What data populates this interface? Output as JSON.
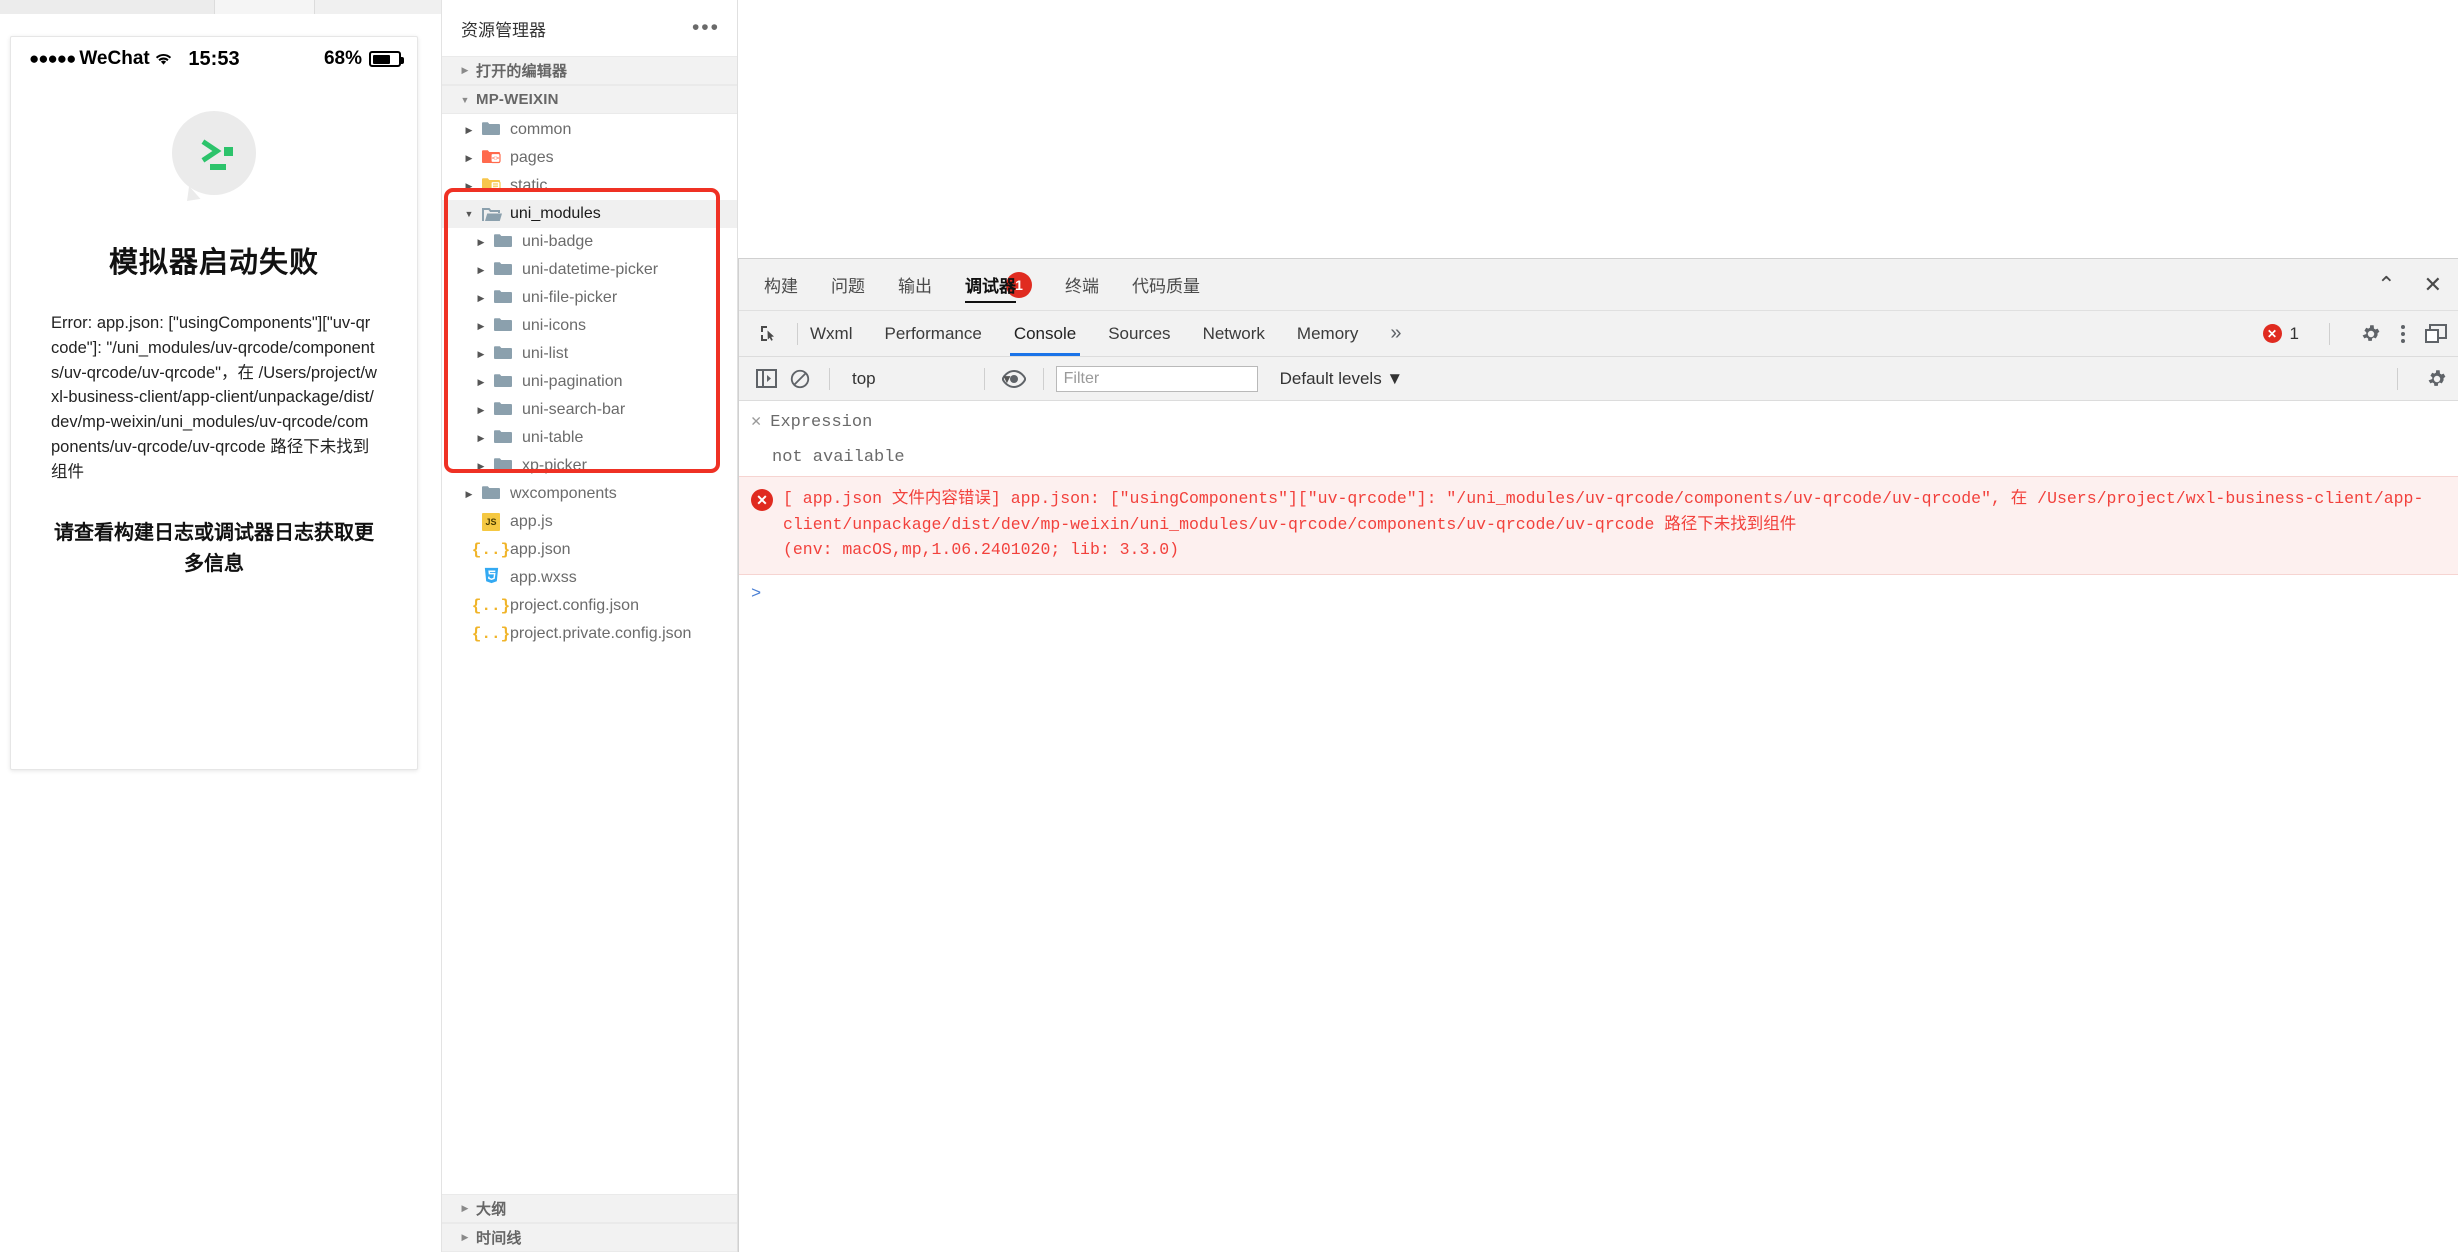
{
  "simulator": {
    "status_bar": {
      "carrier": "WeChat",
      "dots": "●●●●●",
      "time": "15:53",
      "battery_percent": "68%"
    },
    "title": "模拟器启动失败",
    "error_text": "Error: app.json: [\"usingComponents\"][\"uv-qrcode\"]: \"/uni_modules/uv-qrcode/components/uv-qrcode/uv-qrcode\"，在 /Users/project/wxl-business-client/app-client/unpackage/dist/dev/mp-weixin/uni_modules/uv-qrcode/components/uv-qrcode/uv-qrcode 路径下未找到组件",
    "hint_text": "请查看构建日志或调试器日志获取更多信息"
  },
  "explorer": {
    "title": "资源管理器",
    "more_label": "•••",
    "open_editors_label": "打开的编辑器",
    "project_label": "MP-WEIXIN",
    "outline_label": "大纲",
    "timeline_label": "时间线",
    "tree": [
      {
        "label": "common",
        "type": "folder",
        "icon": "folder-gray",
        "indent": 1,
        "expanded": false,
        "selected": false
      },
      {
        "label": "pages",
        "type": "folder",
        "icon": "folder-orange",
        "indent": 1,
        "expanded": false,
        "selected": false
      },
      {
        "label": "static",
        "type": "folder",
        "icon": "folder-yellow",
        "indent": 1,
        "expanded": false,
        "selected": false
      },
      {
        "label": "uni_modules",
        "type": "folder",
        "icon": "folder-open",
        "indent": 1,
        "expanded": true,
        "selected": true
      },
      {
        "label": "uni-badge",
        "type": "folder",
        "icon": "folder-gray",
        "indent": 2,
        "expanded": false,
        "selected": false
      },
      {
        "label": "uni-datetime-picker",
        "type": "folder",
        "icon": "folder-gray",
        "indent": 2,
        "expanded": false,
        "selected": false
      },
      {
        "label": "uni-file-picker",
        "type": "folder",
        "icon": "folder-gray",
        "indent": 2,
        "expanded": false,
        "selected": false
      },
      {
        "label": "uni-icons",
        "type": "folder",
        "icon": "folder-gray",
        "indent": 2,
        "expanded": false,
        "selected": false
      },
      {
        "label": "uni-list",
        "type": "folder",
        "icon": "folder-gray",
        "indent": 2,
        "expanded": false,
        "selected": false
      },
      {
        "label": "uni-pagination",
        "type": "folder",
        "icon": "folder-gray",
        "indent": 2,
        "expanded": false,
        "selected": false
      },
      {
        "label": "uni-search-bar",
        "type": "folder",
        "icon": "folder-gray",
        "indent": 2,
        "expanded": false,
        "selected": false
      },
      {
        "label": "uni-table",
        "type": "folder",
        "icon": "folder-gray",
        "indent": 2,
        "expanded": false,
        "selected": false
      },
      {
        "label": "xp-picker",
        "type": "folder",
        "icon": "folder-gray",
        "indent": 2,
        "expanded": false,
        "selected": false
      },
      {
        "label": "wxcomponents",
        "type": "folder",
        "icon": "folder-gray",
        "indent": 1,
        "expanded": false,
        "selected": false
      },
      {
        "label": "app.js",
        "type": "file",
        "icon": "js-icon",
        "indent": 1,
        "expanded": false,
        "selected": false
      },
      {
        "label": "app.json",
        "type": "file",
        "icon": "json-icon",
        "indent": 1,
        "expanded": false,
        "selected": false
      },
      {
        "label": "app.wxss",
        "type": "file",
        "icon": "css-icon",
        "indent": 1,
        "expanded": false,
        "selected": false
      },
      {
        "label": "project.config.json",
        "type": "file",
        "icon": "json-icon",
        "indent": 1,
        "expanded": false,
        "selected": false
      },
      {
        "label": "project.private.config.json",
        "type": "file",
        "icon": "json-icon",
        "indent": 1,
        "expanded": false,
        "selected": false
      }
    ]
  },
  "devtools": {
    "tabs": [
      {
        "label": "构建",
        "active": false
      },
      {
        "label": "问题",
        "active": false
      },
      {
        "label": "输出",
        "active": false
      },
      {
        "label": "调试器",
        "active": true
      },
      {
        "label": "终端",
        "active": false
      },
      {
        "label": "代码质量",
        "active": false
      }
    ],
    "debugger_badge": "1",
    "panel_tabs": [
      {
        "label": "Wxml",
        "active": false
      },
      {
        "label": "Performance",
        "active": false
      },
      {
        "label": "Console",
        "active": true
      },
      {
        "label": "Sources",
        "active": false
      },
      {
        "label": "Network",
        "active": false
      },
      {
        "label": "Memory",
        "active": false
      }
    ],
    "more_tabs_label": "»",
    "error_count": "1",
    "console": {
      "context": "top",
      "filter_placeholder": "Filter",
      "levels_label": "Default levels",
      "expression_label": "Expression",
      "expression_value": "not available",
      "prompt": ">",
      "message": "[ app.json 文件内容错误] app.json: [\"usingComponents\"][\"uv-qrcode\"]: \"/uni_modules/uv-qrcode/components/uv-qrcode/uv-qrcode\", 在 /Users/project/wxl-business-client/app-client/unpackage/dist/dev/mp-weixin/uni_modules/uv-qrcode/components/uv-qrcode/uv-qrcode 路径下未找到组件\n(env: macOS,mp,1.06.2401020; lib: 3.3.0)"
    },
    "window_controls": {
      "collapse": "⌃",
      "close": "✕"
    }
  },
  "colors": {
    "accent_red": "#ef3124",
    "error_red": "#e02b20",
    "tab_blue": "#1a73e8",
    "wechat_green": "#2cc36b"
  }
}
